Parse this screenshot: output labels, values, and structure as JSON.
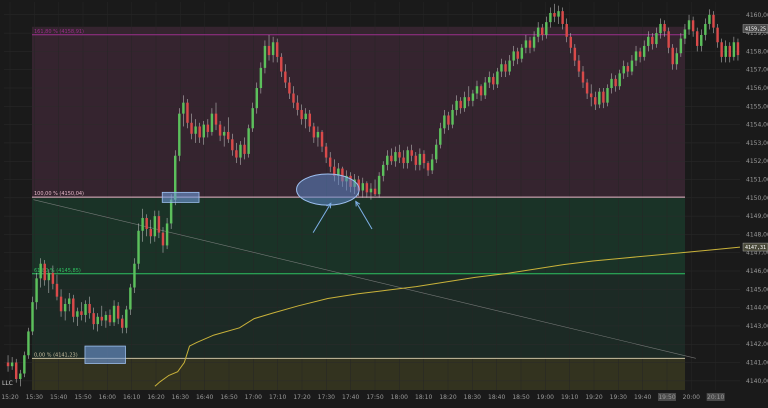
{
  "chart_data": {
    "type": "candlestick",
    "x_ticks": [
      "15:20",
      "15:30",
      "15:40",
      "15:50",
      "16:00",
      "16:10",
      "16:20",
      "16:30",
      "16:40",
      "16:50",
      "17:00",
      "17:10",
      "17:20",
      "17:30",
      "17:40",
      "17:50",
      "18:00",
      "18:10",
      "18:20",
      "18:30",
      "18:40",
      "18:50",
      "19:00",
      "19:10",
      "19:20",
      "19:30",
      "19:40",
      "19:50",
      "20:00",
      "20:10"
    ],
    "x_markers": [
      "19:50",
      "20:10"
    ],
    "y_ticks": [
      "4160,00",
      "4159,00",
      "4158,00",
      "4157,00",
      "4156,00",
      "4155,00",
      "4154,00",
      "4153,00",
      "4152,00",
      "4151,00",
      "4150,00",
      "4149,00",
      "4148,00",
      "4147,00",
      "4146,00",
      "4145,00",
      "4144,00",
      "4143,00",
      "4142,00",
      "4141,00",
      "4140,00"
    ],
    "ylim": [
      4139.5,
      4160.7
    ],
    "price_labels": [
      {
        "text": "4159,25",
        "value": 4159.25,
        "bg": "#4a4a4a"
      },
      {
        "text": "4147,31",
        "value": 4147.31,
        "bg": "#4a4a3a"
      }
    ],
    "fib_levels": [
      {
        "label": "161,80 % (4158,91)",
        "value": 4158.91,
        "color": "#9b2f8c"
      },
      {
        "label": "100,00 % (4150,04)",
        "value": 4150.04,
        "color": "#e6b8c8"
      },
      {
        "label": "61,80 % (4145,85)",
        "value": 4145.85,
        "color": "#2ec060"
      },
      {
        "label": "0,00 % (4141,23)",
        "value": 4141.23,
        "color": "#c8bfa0"
      }
    ],
    "corner_label": "LLC",
    "candles": [
      [
        4141.0,
        4141.4,
        4140.5,
        4140.8
      ],
      [
        4140.8,
        4141.3,
        4140.6,
        4141.0
      ],
      [
        4141.0,
        4141.2,
        4139.9,
        4140.1
      ],
      [
        4140.1,
        4140.6,
        4139.7,
        4140.4
      ],
      [
        4140.4,
        4141.6,
        4140.2,
        4141.4
      ],
      [
        4141.4,
        4142.9,
        4141.2,
        4142.7
      ],
      [
        4142.7,
        4144.6,
        4142.5,
        4144.3
      ],
      [
        4144.3,
        4145.9,
        4143.9,
        4145.6
      ],
      [
        4145.6,
        4146.7,
        4145.1,
        4146.4
      ],
      [
        4146.4,
        4146.6,
        4145.2,
        4145.5
      ],
      [
        4145.5,
        4146.1,
        4144.8,
        4145.9
      ],
      [
        4145.9,
        4146.3,
        4145.0,
        4145.3
      ],
      [
        4145.3,
        4145.8,
        4144.4,
        4144.6
      ],
      [
        4144.6,
        4145.0,
        4143.5,
        4143.8
      ],
      [
        4143.8,
        4144.5,
        4143.3,
        4144.2
      ],
      [
        4144.2,
        4144.8,
        4143.8,
        4144.5
      ],
      [
        4144.5,
        4144.7,
        4143.2,
        4143.5
      ],
      [
        4143.5,
        4144.0,
        4143.0,
        4143.8
      ],
      [
        4143.8,
        4144.3,
        4143.3,
        4143.6
      ],
      [
        4143.6,
        4144.4,
        4143.2,
        4144.2
      ],
      [
        4144.2,
        4144.6,
        4143.4,
        4143.7
      ],
      [
        4143.7,
        4144.0,
        4142.8,
        4143.1
      ],
      [
        4143.1,
        4143.7,
        4142.7,
        4143.5
      ],
      [
        4143.5,
        4144.1,
        4143.0,
        4143.3
      ],
      [
        4143.3,
        4143.8,
        4142.9,
        4143.6
      ],
      [
        4143.6,
        4143.9,
        4143.0,
        4143.2
      ],
      [
        4143.2,
        4144.4,
        4143.0,
        4144.1
      ],
      [
        4144.1,
        4144.3,
        4143.1,
        4143.4
      ],
      [
        4143.4,
        4143.6,
        4142.6,
        4142.9
      ],
      [
        4142.9,
        4144.1,
        4142.6,
        4143.9
      ],
      [
        4143.9,
        4145.3,
        4143.6,
        4145.1
      ],
      [
        4145.1,
        4146.7,
        4144.8,
        4146.4
      ],
      [
        4146.4,
        4148.6,
        4146.1,
        4148.2
      ],
      [
        4148.2,
        4149.4,
        4147.6,
        4148.9
      ],
      [
        4148.9,
        4149.1,
        4147.9,
        4148.3
      ],
      [
        4148.3,
        4148.8,
        4147.5,
        4147.9
      ],
      [
        4147.9,
        4149.3,
        4147.6,
        4149.0
      ],
      [
        4149.0,
        4149.3,
        4147.8,
        4148.1
      ],
      [
        4148.1,
        4148.4,
        4147.0,
        4147.4
      ],
      [
        4147.4,
        4148.9,
        4147.2,
        4148.6
      ],
      [
        4148.6,
        4150.2,
        4148.3,
        4149.9
      ],
      [
        4149.9,
        4152.6,
        4149.6,
        4152.3
      ],
      [
        4152.3,
        4154.9,
        4152.0,
        4154.6
      ],
      [
        4154.6,
        4155.6,
        4153.9,
        4155.2
      ],
      [
        4155.2,
        4155.4,
        4153.8,
        4154.1
      ],
      [
        4154.1,
        4154.6,
        4153.2,
        4153.5
      ],
      [
        4153.5,
        4154.3,
        4153.0,
        4153.9
      ],
      [
        4153.9,
        4154.1,
        4153.0,
        4153.3
      ],
      [
        4153.3,
        4154.2,
        4152.9,
        4154.0
      ],
      [
        4154.0,
        4154.3,
        4153.3,
        4153.6
      ],
      [
        4153.6,
        4154.9,
        4153.4,
        4154.6
      ],
      [
        4154.6,
        4155.2,
        4153.7,
        4154.0
      ],
      [
        4154.0,
        4154.2,
        4153.1,
        4153.4
      ],
      [
        4153.4,
        4153.9,
        4152.8,
        4153.6
      ],
      [
        4153.6,
        4154.4,
        4153.0,
        4153.2
      ],
      [
        4153.2,
        4153.5,
        4152.3,
        4152.6
      ],
      [
        4152.6,
        4153.0,
        4151.9,
        4152.2
      ],
      [
        4152.2,
        4153.1,
        4151.8,
        4152.9
      ],
      [
        4152.9,
        4153.3,
        4152.1,
        4152.4
      ],
      [
        4152.4,
        4154.0,
        4152.2,
        4153.8
      ],
      [
        4153.8,
        4155.2,
        4153.6,
        4154.9
      ],
      [
        4154.9,
        4156.3,
        4154.6,
        4156.0
      ],
      [
        4156.0,
        4157.4,
        4155.7,
        4157.1
      ],
      [
        4157.1,
        4158.6,
        4156.8,
        4158.3
      ],
      [
        4158.3,
        4158.9,
        4157.5,
        4157.8
      ],
      [
        4157.8,
        4158.8,
        4157.4,
        4158.5
      ],
      [
        4158.5,
        4158.7,
        4157.4,
        4157.7
      ],
      [
        4157.7,
        4157.9,
        4156.6,
        4156.9
      ],
      [
        4156.9,
        4157.3,
        4156.0,
        4156.3
      ],
      [
        4156.3,
        4156.6,
        4155.4,
        4155.7
      ],
      [
        4155.7,
        4156.1,
        4154.9,
        4155.2
      ],
      [
        4155.2,
        4155.6,
        4154.5,
        4154.8
      ],
      [
        4154.8,
        4155.1,
        4154.0,
        4154.3
      ],
      [
        4154.3,
        4154.9,
        4153.8,
        4154.6
      ],
      [
        4154.6,
        4154.8,
        4153.6,
        4153.9
      ],
      [
        4153.9,
        4154.1,
        4153.0,
        4153.3
      ],
      [
        4153.3,
        4153.9,
        4152.8,
        4153.6
      ],
      [
        4153.6,
        4153.7,
        4152.5,
        4152.8
      ],
      [
        4152.8,
        4153.0,
        4151.9,
        4152.2
      ],
      [
        4152.2,
        4152.5,
        4151.4,
        4151.7
      ],
      [
        4151.7,
        4152.1,
        4150.9,
        4151.2
      ],
      [
        4151.2,
        4151.9,
        4150.7,
        4151.6
      ],
      [
        4151.6,
        4151.7,
        4150.6,
        4150.9
      ],
      [
        4150.9,
        4151.5,
        4150.4,
        4151.2
      ],
      [
        4151.2,
        4151.4,
        4150.3,
        4150.6
      ],
      [
        4150.6,
        4151.3,
        4150.2,
        4151.0
      ],
      [
        4151.0,
        4151.2,
        4150.1,
        4150.4
      ],
      [
        4150.4,
        4151.1,
        4150.0,
        4150.8
      ],
      [
        4150.8,
        4150.9,
        4150.0,
        4150.3
      ],
      [
        4150.3,
        4150.8,
        4149.9,
        4150.5
      ],
      [
        4150.5,
        4151.0,
        4150.1,
        4150.2
      ],
      [
        4150.2,
        4151.4,
        4150.0,
        4151.2
      ],
      [
        4151.2,
        4152.0,
        4150.9,
        4151.8
      ],
      [
        4151.8,
        4152.6,
        4151.5,
        4152.3
      ],
      [
        4152.3,
        4152.7,
        4151.8,
        4152.0
      ],
      [
        4152.0,
        4152.8,
        4151.7,
        4152.5
      ],
      [
        4152.5,
        4152.9,
        4151.9,
        4152.2
      ],
      [
        4152.2,
        4152.6,
        4151.6,
        4151.9
      ],
      [
        4151.9,
        4152.8,
        4151.6,
        4152.6
      ],
      [
        4152.6,
        4152.9,
        4152.0,
        4152.3
      ],
      [
        4152.3,
        4152.5,
        4151.5,
        4151.8
      ],
      [
        4151.8,
        4152.7,
        4151.5,
        4152.4
      ],
      [
        4152.4,
        4152.6,
        4151.6,
        4151.9
      ],
      [
        4151.9,
        4152.0,
        4151.2,
        4151.5
      ],
      [
        4151.5,
        4152.4,
        4151.3,
        4152.1
      ],
      [
        4152.1,
        4153.2,
        4151.9,
        4152.9
      ],
      [
        4152.9,
        4154.1,
        4152.7,
        4153.8
      ],
      [
        4153.8,
        4154.8,
        4153.5,
        4154.5
      ],
      [
        4154.5,
        4154.7,
        4153.7,
        4154.0
      ],
      [
        4154.0,
        4155.1,
        4153.8,
        4154.8
      ],
      [
        4154.8,
        4155.6,
        4154.5,
        4155.3
      ],
      [
        4155.3,
        4155.5,
        4154.6,
        4154.9
      ],
      [
        4154.9,
        4155.8,
        4154.7,
        4155.5
      ],
      [
        4155.5,
        4156.1,
        4155.0,
        4155.3
      ],
      [
        4155.3,
        4155.9,
        4155.0,
        4155.7
      ],
      [
        4155.7,
        4156.4,
        4155.4,
        4156.1
      ],
      [
        4156.1,
        4156.2,
        4155.3,
        4155.6
      ],
      [
        4155.6,
        4156.6,
        4155.4,
        4156.3
      ],
      [
        4156.3,
        4156.9,
        4156.0,
        4156.6
      ],
      [
        4156.6,
        4156.8,
        4155.9,
        4156.2
      ],
      [
        4156.2,
        4157.1,
        4156.0,
        4156.9
      ],
      [
        4156.9,
        4157.6,
        4156.6,
        4157.3
      ],
      [
        4157.3,
        4157.5,
        4156.6,
        4156.9
      ],
      [
        4156.9,
        4157.8,
        4156.7,
        4157.5
      ],
      [
        4157.5,
        4158.3,
        4157.2,
        4158.0
      ],
      [
        4158.0,
        4158.2,
        4157.3,
        4157.6
      ],
      [
        4157.6,
        4158.4,
        4157.4,
        4158.2
      ],
      [
        4158.2,
        4158.9,
        4157.9,
        4158.6
      ],
      [
        4158.6,
        4158.8,
        4157.9,
        4158.2
      ],
      [
        4158.2,
        4159.1,
        4158.0,
        4158.8
      ],
      [
        4158.8,
        4159.6,
        4158.5,
        4159.3
      ],
      [
        4159.3,
        4159.5,
        4158.6,
        4158.9
      ],
      [
        4158.9,
        4159.9,
        4158.7,
        4159.6
      ],
      [
        4159.6,
        4160.4,
        4159.3,
        4160.1
      ],
      [
        4160.1,
        4160.6,
        4159.6,
        4159.9
      ],
      [
        4159.9,
        4160.5,
        4159.5,
        4160.2
      ],
      [
        4160.2,
        4160.4,
        4159.2,
        4159.5
      ],
      [
        4159.5,
        4159.8,
        4158.5,
        4158.8
      ],
      [
        4158.8,
        4159.0,
        4157.9,
        4158.2
      ],
      [
        4158.2,
        4158.4,
        4157.2,
        4157.5
      ],
      [
        4157.5,
        4157.8,
        4156.6,
        4156.9
      ],
      [
        4156.9,
        4157.2,
        4156.0,
        4156.3
      ],
      [
        4156.3,
        4156.5,
        4155.4,
        4155.7
      ],
      [
        4155.7,
        4156.2,
        4155.0,
        4155.5
      ],
      [
        4155.5,
        4155.8,
        4154.8,
        4155.1
      ],
      [
        4155.1,
        4156.0,
        4154.9,
        4155.8
      ],
      [
        4155.8,
        4156.0,
        4154.9,
        4155.2
      ],
      [
        4155.2,
        4156.2,
        4155.0,
        4156.0
      ],
      [
        4156.0,
        4156.8,
        4155.7,
        4156.5
      ],
      [
        4156.5,
        4156.7,
        4155.8,
        4156.1
      ],
      [
        4156.1,
        4157.0,
        4155.9,
        4156.8
      ],
      [
        4156.8,
        4157.5,
        4156.5,
        4157.2
      ],
      [
        4157.2,
        4157.4,
        4156.6,
        4156.9
      ],
      [
        4156.9,
        4157.8,
        4156.7,
        4157.5
      ],
      [
        4157.5,
        4158.3,
        4157.2,
        4158.0
      ],
      [
        4158.0,
        4158.2,
        4157.4,
        4157.7
      ],
      [
        4157.7,
        4158.6,
        4157.5,
        4158.3
      ],
      [
        4158.3,
        4159.1,
        4158.0,
        4158.8
      ],
      [
        4158.8,
        4159.0,
        4158.1,
        4158.4
      ],
      [
        4158.4,
        4159.3,
        4158.2,
        4159.0
      ],
      [
        4159.0,
        4159.8,
        4158.7,
        4159.5
      ],
      [
        4159.5,
        4159.7,
        4158.8,
        4159.1
      ],
      [
        4159.1,
        4159.3,
        4157.9,
        4158.2
      ],
      [
        4158.2,
        4158.4,
        4157.0,
        4157.3
      ],
      [
        4157.3,
        4158.2,
        4157.0,
        4157.9
      ],
      [
        4157.9,
        4159.0,
        4157.7,
        4158.7
      ],
      [
        4158.7,
        4159.5,
        4158.4,
        4159.2
      ],
      [
        4159.2,
        4160.0,
        4158.9,
        4159.7
      ],
      [
        4159.7,
        4159.9,
        4158.8,
        4159.1
      ],
      [
        4159.1,
        4159.3,
        4158.0,
        4158.3
      ],
      [
        4158.3,
        4159.2,
        4158.0,
        4158.9
      ],
      [
        4158.9,
        4159.8,
        4158.6,
        4159.5
      ],
      [
        4159.5,
        4160.3,
        4159.2,
        4160.0
      ],
      [
        4160.0,
        4160.2,
        4159.0,
        4159.3
      ],
      [
        4159.3,
        4159.5,
        4158.2,
        4158.5
      ],
      [
        4158.5,
        4158.7,
        4157.4,
        4157.7
      ],
      [
        4157.7,
        4158.6,
        4157.4,
        4158.3
      ],
      [
        4158.3,
        4158.5,
        4157.4,
        4157.7
      ],
      [
        4157.7,
        4158.8,
        4157.5,
        4158.5
      ],
      [
        4158.5,
        4158.7,
        4157.5,
        4157.8
      ]
    ],
    "vwap": [
      [
        0.205,
        4139.7
      ],
      [
        0.212,
        4139.95
      ],
      [
        0.224,
        4140.3
      ],
      [
        0.236,
        4140.5
      ],
      [
        0.245,
        4141.0
      ],
      [
        0.252,
        4141.9
      ],
      [
        0.262,
        4142.1
      ],
      [
        0.285,
        4142.5
      ],
      [
        0.32,
        4142.9
      ],
      [
        0.34,
        4143.4
      ],
      [
        0.365,
        4143.7
      ],
      [
        0.4,
        4144.1
      ],
      [
        0.44,
        4144.5
      ],
      [
        0.48,
        4144.75
      ],
      [
        0.52,
        4144.95
      ],
      [
        0.56,
        4145.15
      ],
      [
        0.6,
        4145.4
      ],
      [
        0.64,
        4145.65
      ],
      [
        0.68,
        4145.85
      ],
      [
        0.72,
        4146.1
      ],
      [
        0.76,
        4146.35
      ],
      [
        0.8,
        4146.55
      ],
      [
        0.84,
        4146.7
      ],
      [
        0.88,
        4146.85
      ],
      [
        0.92,
        4147.0
      ],
      [
        0.96,
        4147.15
      ],
      [
        1.0,
        4147.31
      ]
    ],
    "trendline": [
      [
        0.04,
        4149.9
      ],
      [
        0.94,
        4141.23
      ]
    ],
    "highlight_boxes": [
      [
        0.215,
        0.265,
        4150.3,
        4149.75
      ],
      [
        0.11,
        0.165,
        4141.9,
        4140.95
      ]
    ],
    "ellipse": [
      0.44,
      4150.45,
      0.085,
      4151.3,
      4149.6
    ],
    "arrows": [
      [
        0.42,
        4148.1,
        0.444,
        4149.7
      ],
      [
        0.5,
        4148.3,
        0.478,
        4149.8
      ]
    ]
  }
}
